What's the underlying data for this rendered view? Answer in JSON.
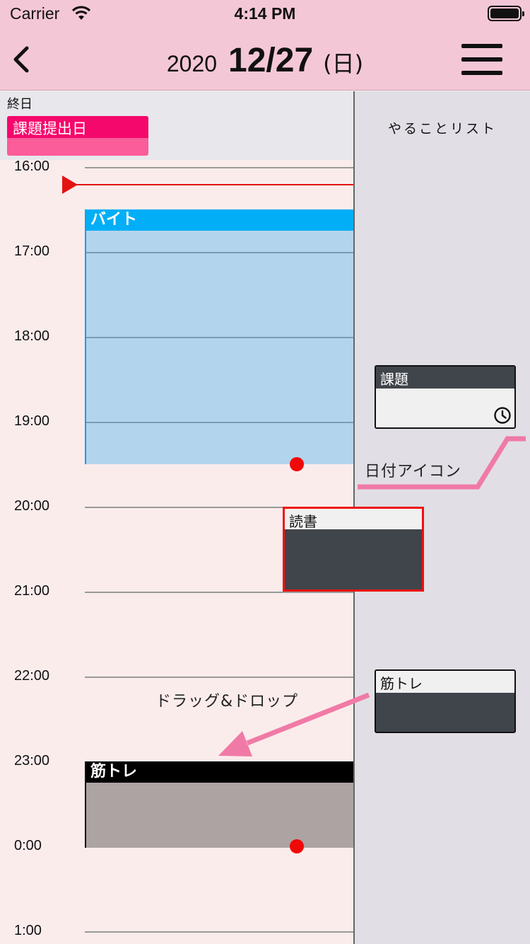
{
  "status": {
    "carrier": "Carrier",
    "time": "4:14 PM"
  },
  "nav": {
    "year": "2020",
    "month_day": "12/27",
    "weekday": "(日)"
  },
  "allday": {
    "label": "終日",
    "event": "課題提出日"
  },
  "timeline": {
    "hours": [
      "16:00",
      "17:00",
      "18:00",
      "19:00",
      "20:00",
      "21:00",
      "22:00",
      "23:00",
      "0:00",
      "1:00"
    ]
  },
  "events": {
    "baito": "バイト",
    "kintore": "筋トレ",
    "dragging": "読書"
  },
  "todo": {
    "title": "やることリスト",
    "items": [
      {
        "label": "課題"
      },
      {
        "label": "筋トレ"
      }
    ]
  },
  "annotations": {
    "date_icon": "日付アイコン",
    "drag_drop": "ドラッグ&ドロップ"
  },
  "colors": {
    "header": "#f4c7d7",
    "allday_event": "#f5086b",
    "baito": "#02aef6",
    "now_line": "#e31313",
    "annotation_arrow": "#f07aa6"
  }
}
